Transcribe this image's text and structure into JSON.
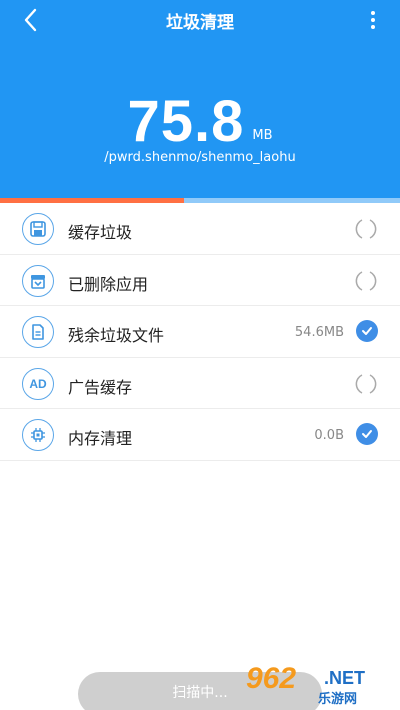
{
  "header": {
    "title": "垃圾清理",
    "junk_size": "75.8",
    "junk_unit": "MB",
    "scan_path": "/pwrd.shenmo/shenmo_laohu",
    "progress": 0.46,
    "colors": {
      "header_bg": "#2196f3",
      "progress_fill": "#ff7043",
      "progress_track": "#90caf9"
    }
  },
  "items": [
    {
      "label": "缓存垃圾",
      "size": "",
      "state": "scanning",
      "icon": "save-icon"
    },
    {
      "label": "已删除应用",
      "size": "",
      "state": "scanning",
      "icon": "archive-icon"
    },
    {
      "label": "残余垃圾文件",
      "size": "54.6MB",
      "state": "checked",
      "icon": "document-icon"
    },
    {
      "label": "广告缓存",
      "size": "",
      "state": "scanning",
      "icon": "ad-icon",
      "icon_text": "AD"
    },
    {
      "label": "内存清理",
      "size": "0.0B",
      "state": "checked",
      "icon": "chip-icon"
    }
  ],
  "scan_button": {
    "label": "扫描中..."
  },
  "watermark": {
    "num": "962",
    "net": ".NET",
    "cn": "乐游网"
  }
}
